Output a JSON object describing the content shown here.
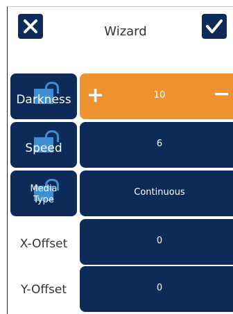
{
  "header": {
    "title": "Wizard",
    "close_icon": "close-icon",
    "confirm_icon": "checkmark-icon"
  },
  "colors": {
    "primary": "#0d2a58",
    "active": "#f0922f",
    "lock": "#3e8ed4",
    "text": "#333333"
  },
  "rows": [
    {
      "label": "Darkness",
      "value": "10",
      "locked": true,
      "active": true,
      "icons": [
        "lock-icon",
        "plus-icon",
        "minus-icon"
      ]
    },
    {
      "label": "Speed",
      "value": "6",
      "locked": true,
      "active": false,
      "icons": [
        "lock-icon"
      ]
    },
    {
      "label_line1": "Media",
      "label_line2": "Type",
      "value": "Continuous",
      "locked": true,
      "active": false,
      "icons": [
        "lock-icon"
      ]
    },
    {
      "label": "X-Offset",
      "value": "0",
      "locked": false,
      "active": false
    },
    {
      "label": "Y-Offset",
      "value": "0",
      "locked": false,
      "active": false
    }
  ],
  "stepper": {
    "plus": "+",
    "minus": "−"
  }
}
